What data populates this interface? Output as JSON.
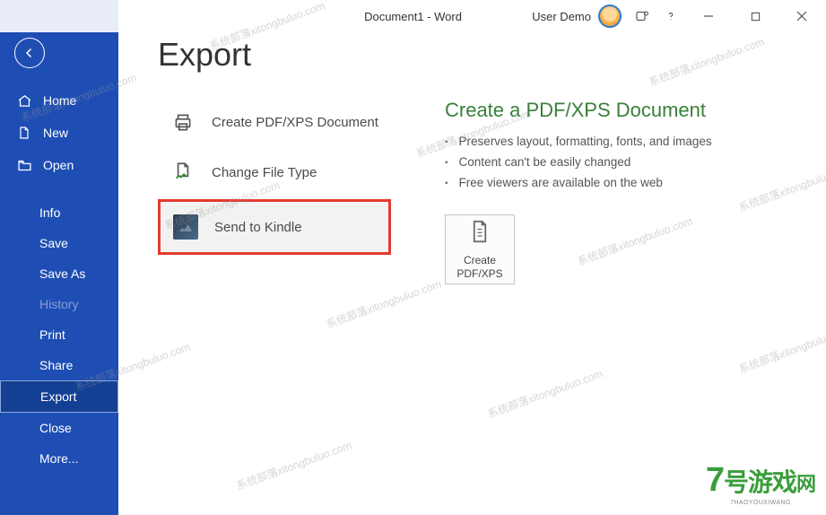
{
  "titlebar": {
    "title": "Document1  -  Word",
    "user": "User Demo"
  },
  "sidebar": {
    "home": "Home",
    "new": "New",
    "open": "Open",
    "info": "Info",
    "save": "Save",
    "save_as": "Save As",
    "history": "History",
    "print": "Print",
    "share": "Share",
    "export": "Export",
    "close": "Close",
    "more": "More..."
  },
  "page": {
    "title": "Export"
  },
  "options": {
    "pdfxps": "Create PDF/XPS Document",
    "change_type": "Change File Type",
    "kindle": "Send to Kindle"
  },
  "details": {
    "heading": "Create a PDF/XPS Document",
    "b1": "Preserves layout, formatting, fonts, and images",
    "b2": "Content can't be easily changed",
    "b3": "Free viewers are available on the web",
    "button_l1": "Create",
    "button_l2": "PDF/XPS"
  },
  "watermark": "系统部落xitongbuluo.com",
  "logo": {
    "seven": "7",
    "text1": "号游戏",
    "text2": "网",
    "sub": "7HAOYOUXIWANG"
  }
}
